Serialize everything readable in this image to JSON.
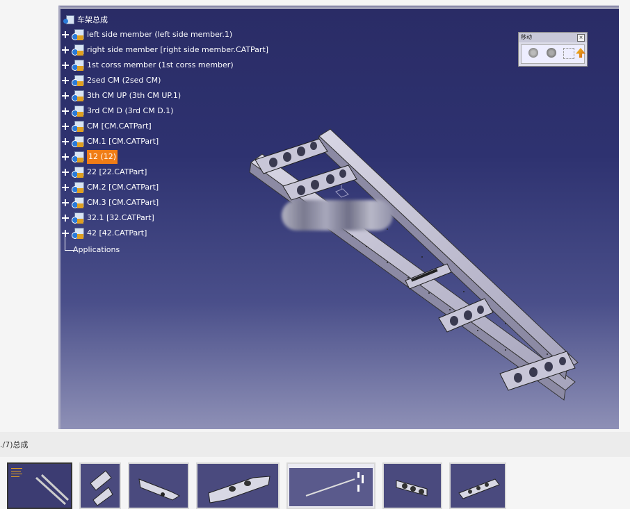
{
  "tree": {
    "root_label": "车架总成",
    "items": [
      {
        "label": "left side member (left side member.1)",
        "selected": false
      },
      {
        "label": "right side member [right side member.CATPart]",
        "selected": false
      },
      {
        "label": "1st corss member (1st corss member)",
        "selected": false
      },
      {
        "label": "2sed CM (2sed CM)",
        "selected": false
      },
      {
        "label": "3th CM UP (3th CM UP.1)",
        "selected": false
      },
      {
        "label": "3rd CM D (3rd CM D.1)",
        "selected": false
      },
      {
        "label": "CM [CM.CATPart]",
        "selected": false
      },
      {
        "label": "CM.1 [CM.CATPart]",
        "selected": false
      },
      {
        "label": "12 (12)",
        "selected": true
      },
      {
        "label": "22 [22.CATPart]",
        "selected": false
      },
      {
        "label": "CM.2 [CM.CATPart]",
        "selected": false
      },
      {
        "label": "CM.3 [CM.CATPart]",
        "selected": false
      },
      {
        "label": "32.1 [32.CATPart]",
        "selected": false
      },
      {
        "label": "42 [42.CATPart]",
        "selected": false
      }
    ],
    "applications_label": "Applications"
  },
  "move_toolbar": {
    "title": "移动",
    "close_label": "×",
    "icons": [
      "pan-icon",
      "rotate-icon",
      "snap-icon",
      "manipulate-icon"
    ]
  },
  "caption": {
    "text": "./7)总成"
  },
  "thumbnails": [
    {
      "name": "frame-assembly-tree",
      "active": true
    },
    {
      "name": "bracket-part",
      "active": false
    },
    {
      "name": "cross-member-part",
      "active": false
    },
    {
      "name": "plate-part",
      "active": false
    },
    {
      "name": "window-screenshot",
      "active": false
    },
    {
      "name": "perforated-member",
      "active": false
    },
    {
      "name": "perforated-beam",
      "active": false
    }
  ],
  "colors": {
    "viewport_top": "#2a2c66",
    "viewport_bottom": "#8e90b6",
    "selection": "#f07d16"
  }
}
